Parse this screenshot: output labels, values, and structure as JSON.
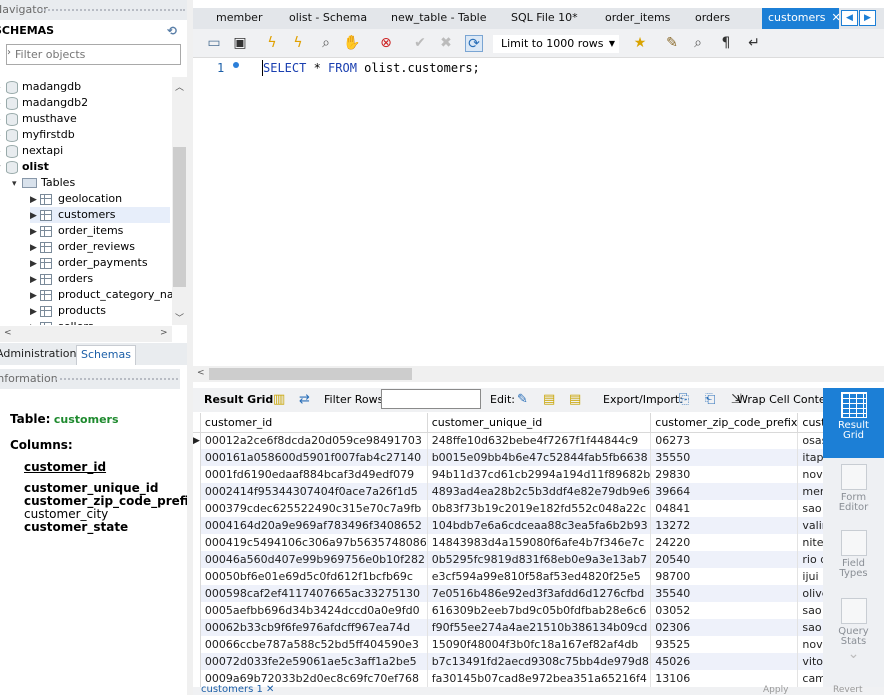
{
  "navigator": {
    "title": "Navigator",
    "schemas_label": "SCHEMAS",
    "filter_placeholder": "Filter objects",
    "databases": [
      "madangdb",
      "madangdb2",
      "musthave",
      "myfirstdb",
      "nextapi"
    ],
    "active_db": "olist",
    "tables_folder": "Tables",
    "tables": [
      "geolocation",
      "customers",
      "order_items",
      "order_reviews",
      "order_payments",
      "orders",
      "product_category_name_translation",
      "products",
      "sellers"
    ],
    "selected_table": "customers"
  },
  "left_tabs": {
    "administration": "Administration",
    "schemas": "Schemas"
  },
  "information": {
    "title": "Information",
    "table_label": "Table:",
    "table_name": "customers",
    "columns_label": "Columns:",
    "columns": [
      "customer_id",
      "customer_unique_id",
      "customer_zip_code_prefix",
      "customer_city",
      "customer_state"
    ]
  },
  "query_tabs": [
    "member",
    "olist - Schema",
    "new_table - Table",
    "SQL File 10*",
    "order_items",
    "orders",
    "customers"
  ],
  "active_tab": "customers",
  "toolbar": {
    "limit_label": "Limit to 1000 rows"
  },
  "editor": {
    "line_number": "1",
    "sql_kw1": "SELECT",
    "sql_mid": " * ",
    "sql_kw2": "FROM",
    "sql_rest": " olist.customers;"
  },
  "result_toolbar": {
    "result_grid": "Result Grid",
    "filter_rows": "Filter Rows:",
    "edit": "Edit:",
    "export_import": "Export/Import:",
    "wrap_cell": "Wrap Cell Content:"
  },
  "grid": {
    "columns": [
      "customer_id",
      "customer_unique_id",
      "customer_zip_code_prefix",
      "customer_city"
    ],
    "rows": [
      [
        "00012a2ce6f8dcda20d059ce98491703",
        "248ffe10d632bebe4f7267f1f44844c9",
        "06273",
        "osasco"
      ],
      [
        "000161a058600d5901f007fab4c27140",
        "b0015e09bb4b6e47c52844fab5fb6638",
        "35550",
        "itapecerica"
      ],
      [
        "0001fd6190edaaf884bcaf3d49edf079",
        "94b11d37cd61cb2994a194d11f89682b",
        "29830",
        "nova venecia"
      ],
      [
        "0002414f95344307404f0ace7a26f1d5",
        "4893ad4ea28b2c5b3ddf4e82e79db9e6",
        "39664",
        "mendonca"
      ],
      [
        "000379cdec625522490c315e70c7a9fb",
        "0b83f73b19c2019e182fd552c048a22c",
        "04841",
        "sao paulo"
      ],
      [
        "0004164d20a9e969af783496f3408652",
        "104bdb7e6a6cdceaa88c3ea5fa6b2b93",
        "13272",
        "valinhos"
      ],
      [
        "000419c5494106c306a97b5635748086",
        "14843983d4a159080f6afe4b7f346e7c",
        "24220",
        "niteroi"
      ],
      [
        "00046a560d407e99b969756e0b10f282",
        "0b5295fc9819d831f68eb0e9a3e13ab7",
        "20540",
        "rio de janeiro"
      ],
      [
        "00050bf6e01e69d5c0fd612f1bcfb69c",
        "e3cf594a99e810f58af53ed4820f25e5",
        "98700",
        "ijui"
      ],
      [
        "000598caf2ef4117407665ac33275130",
        "7e0516b486e92ed3f3afdd6d1276cfbd",
        "35540",
        "oliveira"
      ],
      [
        "0005aefbb696d34b3424dccd0a0e9fd0",
        "616309b2eeb7bd9c05b0fdfbab28e6c6",
        "03052",
        "sao paulo"
      ],
      [
        "00062b33cb9f6fe976afdcff967ea74d",
        "f90f55ee274a4ae21510b386134b09cd",
        "02306",
        "sao paulo"
      ],
      [
        "00066ccbe787a588c52bd5ff404590e3",
        "15090f48004f3b0fc18a167ef82af4db",
        "93525",
        "novo hamburgo"
      ],
      [
        "00072d033fe2e59061ae5c3aff1a2be5",
        "b7c13491fd2aecd9308c75bb4de979d8",
        "45026",
        "vitoria da conquista"
      ],
      [
        "0009a69b72033b2d0ec8c69fc70ef768",
        "fa30145b07cad8e972bea351a65216f4",
        "13106",
        "campinas"
      ]
    ]
  },
  "side_panel": {
    "result_grid": [
      "Result",
      "Grid"
    ],
    "form_editor": [
      "Form",
      "Editor"
    ],
    "field_types": [
      "Field",
      "Types"
    ],
    "query_stats": [
      "Query",
      "Stats"
    ]
  },
  "footer": {
    "result_tab": "customers 1",
    "apply": "Apply",
    "revert": "Revert"
  }
}
